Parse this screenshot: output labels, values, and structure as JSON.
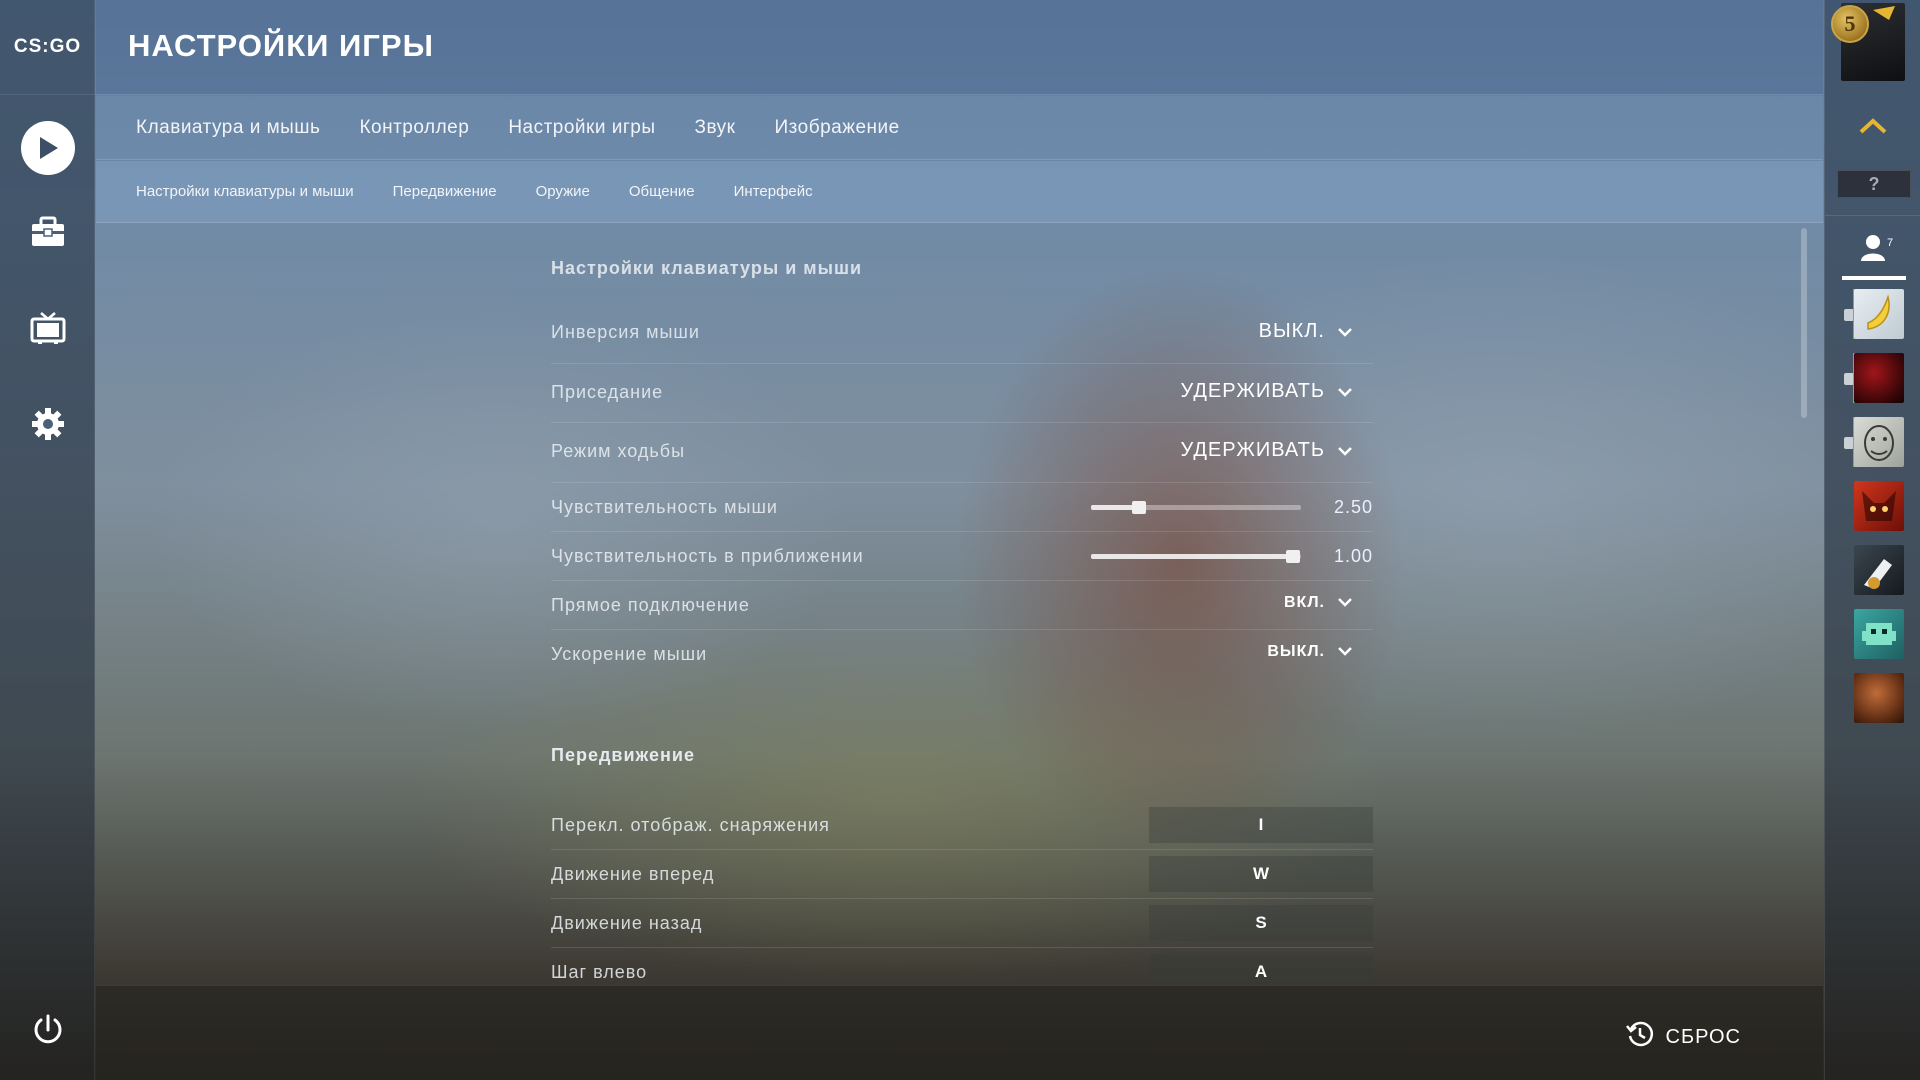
{
  "app": {
    "logo_text": "CS:GO"
  },
  "header": {
    "title": "НАСТРОЙКИ ИГРЫ"
  },
  "tabs": [
    {
      "label": "Клавиатура и мышь"
    },
    {
      "label": "Контроллер"
    },
    {
      "label": "Настройки игры"
    },
    {
      "label": "Звук"
    },
    {
      "label": "Изображение"
    }
  ],
  "subtabs": [
    {
      "label": "Настройки клавиатуры и мыши"
    },
    {
      "label": "Передвижение"
    },
    {
      "label": "Оружие"
    },
    {
      "label": "Общение"
    },
    {
      "label": "Интерфейс"
    }
  ],
  "section_keyboard": {
    "title": "Настройки клавиатуры и мыши",
    "rows": [
      {
        "label": "Инверсия мыши",
        "value": "ВЫКЛ."
      },
      {
        "label": "Приседание",
        "value": "УДЕРЖИВАТЬ"
      },
      {
        "label": "Режим ходьбы",
        "value": "УДЕРЖИВАТЬ"
      },
      {
        "label": "Чувствительность мыши",
        "value": "2.50",
        "slider_fraction": 0.23
      },
      {
        "label": "Чувствительность в приближении",
        "value": "1.00",
        "slider_fraction": 0.96
      },
      {
        "label": "Прямое подключение",
        "value": "ВКЛ."
      },
      {
        "label": "Ускорение мыши",
        "value": "ВЫКЛ."
      }
    ]
  },
  "section_movement": {
    "title": "Передвижение",
    "rows": [
      {
        "label": "Перекл. отображ. снаряжения",
        "key": "I"
      },
      {
        "label": "Движение вперед",
        "key": "W"
      },
      {
        "label": "Движение назад",
        "key": "S"
      },
      {
        "label": "Шаг влево",
        "key": "A"
      }
    ]
  },
  "footer": {
    "reset_label": "СБРОС"
  },
  "right_panel": {
    "rank_number": "5",
    "help_label": "?",
    "friends_count": "7"
  },
  "icons": {
    "play": "play-icon",
    "inventory": "briefcase-icon",
    "watch": "tv-icon",
    "settings": "gear-icon",
    "power": "power-icon",
    "reset": "history-icon",
    "chevron": "chevron-down-icon",
    "expand": "chevron-up-icon",
    "friends": "person-icon"
  },
  "colors": {
    "accent_gold": "#e6b531",
    "online_green": "#57c261"
  }
}
